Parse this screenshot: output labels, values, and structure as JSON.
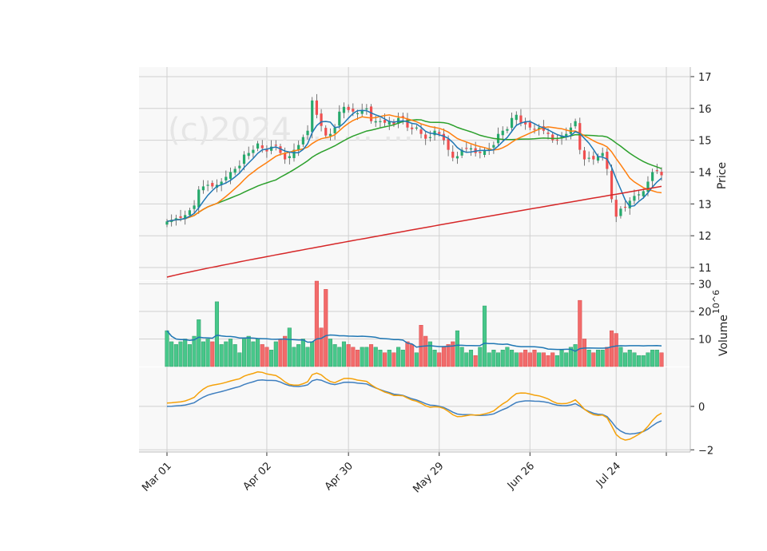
{
  "watermark": "(c)2024 ... ... ...",
  "colors": {
    "panel_bg": "#f8f8f8",
    "grid": "#d0d0d0",
    "up": "#26a96c",
    "down": "#ef4f4f",
    "vol_up": "#47c78a",
    "vol_down": "#f26b6b",
    "ma_short": "#1f77b4",
    "ma_mid": "#ff7f0e",
    "ma_long": "#2ca02c",
    "ma_200": "#d62728",
    "vol_ma": "#1f77b4",
    "osc_fast": "#3f7fbf",
    "osc_slow": "#f5a20a"
  },
  "chart_data": {
    "type": "candlestick",
    "x_tick_labels": [
      "Mar 01",
      "Apr 02",
      "Apr 30",
      "May 29",
      "Jun 26",
      "Jul 24"
    ],
    "price_panel": {
      "ylabel": "Price",
      "yticks": [
        11,
        12,
        13,
        14,
        15,
        16,
        17
      ],
      "ylim": [
        10.6,
        17.3
      ]
    },
    "volume_panel": {
      "ylabel": "Volume",
      "ylabel_exponent": "10^6",
      "yticks": [
        10,
        20,
        30
      ],
      "ylim": [
        0,
        31
      ]
    },
    "oscillator_panel": {
      "yticks": [
        -2,
        0
      ],
      "ylim": [
        -2.1,
        1.8
      ]
    },
    "close_series": [
      12.45,
      12.5,
      12.55,
      12.56,
      12.65,
      12.8,
      12.95,
      13.45,
      13.55,
      13.6,
      13.55,
      13.6,
      13.7,
      13.85,
      14.0,
      14.1,
      14.2,
      14.55,
      14.6,
      14.7,
      14.9,
      14.75,
      14.65,
      14.8,
      14.85,
      14.6,
      14.4,
      14.5,
      14.7,
      14.85,
      15.1,
      15.3,
      16.25,
      15.8,
      15.45,
      15.15,
      15.2,
      15.4,
      15.9,
      16.05,
      15.95,
      15.9,
      15.85,
      15.95,
      16.0,
      15.6,
      15.6,
      15.6,
      15.55,
      15.6,
      15.5,
      15.7,
      15.7,
      15.4,
      15.35,
      15.4,
      15.2,
      15.05,
      15.1,
      15.3,
      15.2,
      15.0,
      14.7,
      14.45,
      14.5,
      14.7,
      14.75,
      14.75,
      14.6,
      14.6,
      14.7,
      14.75,
      14.85,
      15.2,
      15.3,
      15.35,
      15.7,
      15.8,
      15.55,
      15.5,
      15.4,
      15.35,
      15.4,
      15.3,
      15.2,
      15.0,
      15.0,
      15.15,
      15.2,
      15.4,
      15.6,
      14.7,
      14.4,
      14.45,
      14.4,
      14.5,
      14.6,
      14.1,
      13.15,
      12.6,
      12.85,
      12.9,
      13.1,
      13.25,
      13.3,
      13.4,
      13.7,
      14.0,
      14.05,
      13.9
    ],
    "volume_series": [
      13,
      9,
      8,
      9,
      10,
      8,
      11,
      17,
      9,
      10,
      9,
      23.5,
      8,
      9,
      10,
      8,
      5,
      10,
      11,
      9,
      10,
      8,
      7,
      6,
      9,
      10,
      11,
      14,
      7,
      8,
      10,
      7,
      9,
      31,
      14,
      28,
      10,
      8,
      7,
      9,
      8,
      7,
      6,
      7,
      7,
      8,
      7,
      6,
      5,
      6,
      5,
      7,
      6,
      9,
      8,
      5,
      15,
      11,
      9,
      6,
      5,
      7,
      8,
      9,
      13,
      7,
      5,
      6,
      4,
      7,
      22,
      5,
      6,
      5,
      6,
      7,
      6,
      5,
      5,
      6,
      5,
      6,
      5,
      5,
      4,
      5,
      4,
      6,
      5,
      7,
      8,
      24,
      10,
      6,
      5,
      6,
      6,
      7,
      13,
      12,
      7,
      5,
      6,
      5,
      4,
      4,
      5,
      6,
      6,
      5
    ],
    "moving_averages": [
      {
        "window": "short",
        "role": "price"
      },
      {
        "window": "mid",
        "role": "price"
      },
      {
        "window": "long",
        "role": "price"
      },
      {
        "window": "200",
        "role": "price"
      },
      {
        "window": "volume",
        "role": "volume"
      }
    ],
    "grid": true
  }
}
